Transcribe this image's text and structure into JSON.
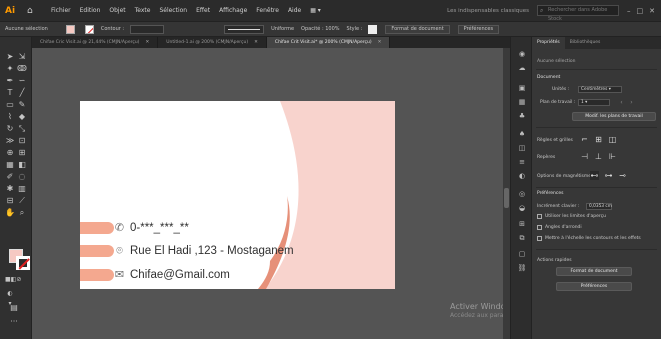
{
  "menubar": {
    "app_logo": "Ai",
    "items": [
      "Fichier",
      "Edition",
      "Objet",
      "Texte",
      "Sélection",
      "Effet",
      "Affichage",
      "Fenêtre",
      "Aide",
      "▦ ▾"
    ],
    "workspace": "Les indispensables classiques",
    "search_placeholder": "Rechercher dans Adobe Stock",
    "window_controls": [
      "–",
      "□",
      "✕"
    ]
  },
  "controlbar": {
    "selection_label": "Aucune sélection",
    "stroke_label": "Contour :",
    "style_label": "Uniforme",
    "opacity_label": "Opacité : 100%",
    "style2_label": "Style :",
    "doc_format_button": "Format de document",
    "prefs_button": "Préférences"
  },
  "tabs": [
    {
      "label": "Chifae Cric Visit.ai @ 21,44% (CMJN/Aperçu)",
      "active": false
    },
    {
      "label": "Untitled-1.ai @ 200% (CMJN/Aperçu)",
      "active": false
    },
    {
      "label": "Chifae Crit Visit.ai* @ 200% (CMJN/Aperçu)",
      "active": true
    }
  ],
  "card": {
    "phone": "0-***_***_**",
    "address": "Rue El Hadi ,123 - Mostaganem",
    "email": "Chifae@Gmail.com",
    "pill_color": "#f4a88f",
    "panel_color": "#f8d3cd",
    "curve_color": "#e69079"
  },
  "watermark": {
    "title": "Activer Windows",
    "subtitle": "Accédez aux paramètres de l'ordinateur pour activer Windows."
  },
  "panel": {
    "tabs": [
      "Propriétés",
      "Bibliothèques"
    ],
    "no_selection": "Aucune sélection",
    "document_header": "Document",
    "units_label": "Unités :",
    "units_value": "Centimètres",
    "artboard_label": "Plan de travail :",
    "artboard_value": "1",
    "edit_artboards_button": "Modif. les plans de travail",
    "rulers_header": "Règles et grilles",
    "guides_header": "Repères",
    "snap_header": "Options de magnétisme",
    "prefs_header": "Préférences",
    "keyboard_label": "Incrément clavier :",
    "keyboard_value": "0,0353 cm",
    "check_preview_bounds": "Utiliser les limites d'aperçu",
    "check_corners": "Angles d'arrondi",
    "check_scale": "Mettre à l'échelle les contours et les effets",
    "quick_actions_header": "Actions rapides",
    "doc_format_button": "Format de document",
    "prefs_button": "Préférences"
  }
}
